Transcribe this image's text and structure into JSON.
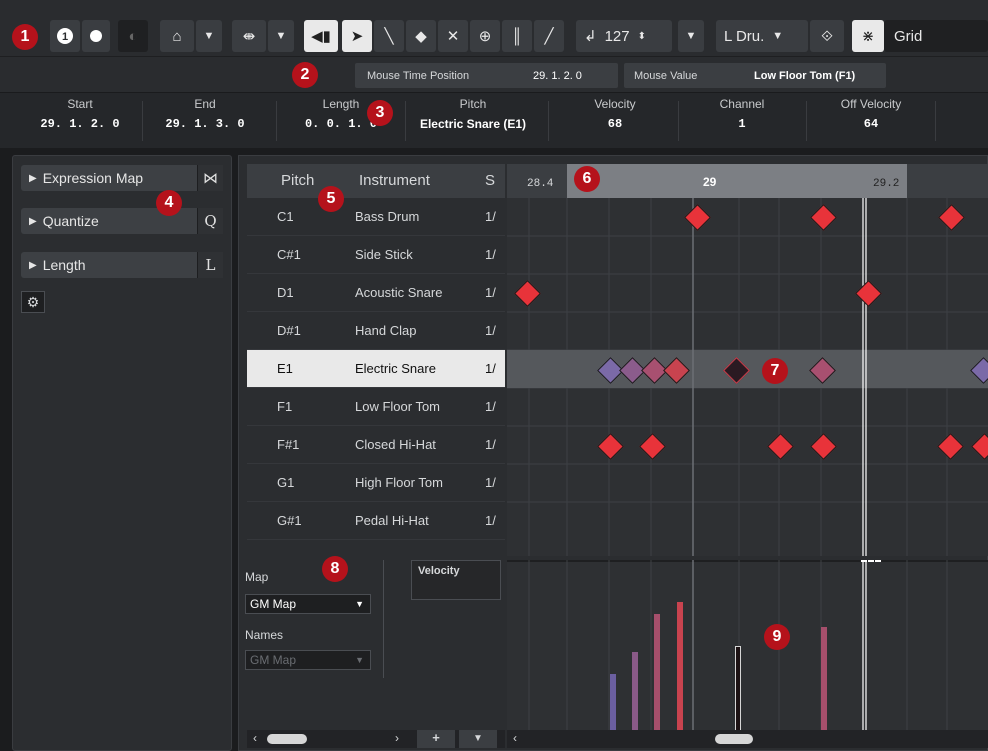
{
  "badges": [
    "1",
    "2",
    "3",
    "4",
    "5",
    "6",
    "7",
    "8",
    "9"
  ],
  "toolbar": {
    "quantity": "127",
    "drum_map_label": "L Dru.",
    "grid_label": "Grid"
  },
  "infobar": {
    "mouse_time_label": "Mouse Time Position",
    "mouse_time_value": "29. 1. 2.  0",
    "mouse_value_label": "Mouse Value",
    "mouse_value": "Low Floor Tom (F1)"
  },
  "statusline": {
    "start_label": "Start",
    "start_value": "29. 1. 2.  0",
    "end_label": "End",
    "end_value": "29. 1. 3.  0",
    "length_label": "Length",
    "length_value": "0. 0. 1.  0",
    "pitch_label": "Pitch",
    "pitch_value": "Electric Snare (E1)",
    "velocity_label": "Velocity",
    "velocity_value": "68",
    "channel_label": "Channel",
    "channel_value": "1",
    "offvel_label": "Off Velocity",
    "offvel_value": "64"
  },
  "inspector": {
    "expression_map": "Expression Map",
    "expression_icon": "⋈",
    "quantize": "Quantize",
    "quantize_key": "Q",
    "length": "Length",
    "length_key": "L"
  },
  "drum_list": {
    "col_pitch": "Pitch",
    "col_instrument": "Instrument",
    "col_s": "S",
    "rows": [
      {
        "pitch": "C1",
        "instrument": "Bass Drum",
        "s": "1/"
      },
      {
        "pitch": "C#1",
        "instrument": "Side Stick",
        "s": "1/"
      },
      {
        "pitch": "D1",
        "instrument": "Acoustic Snare",
        "s": "1/"
      },
      {
        "pitch": "D#1",
        "instrument": "Hand Clap",
        "s": "1/"
      },
      {
        "pitch": "E1",
        "instrument": "Electric Snare",
        "s": "1/"
      },
      {
        "pitch": "F1",
        "instrument": "Low Floor Tom",
        "s": "1/"
      },
      {
        "pitch": "F#1",
        "instrument": "Closed Hi-Hat",
        "s": "1/"
      },
      {
        "pitch": "G1",
        "instrument": "High Floor Tom",
        "s": "1/"
      },
      {
        "pitch": "G#1",
        "instrument": "Pedal Hi-Hat",
        "s": "1/"
      }
    ]
  },
  "ruler": {
    "m1": "28.4",
    "m2": "29",
    "m3": "29.2"
  },
  "lower": {
    "map_label": "Map",
    "map_value": "GM Map",
    "names_label": "Names",
    "names_value": "GM Map",
    "velocity_lane": "Velocity"
  },
  "colors": {
    "accent_badge": "#b5121b",
    "note_red": "#e8333a",
    "note_purple": "#7b6aa8",
    "note_muted": "#a85070"
  }
}
